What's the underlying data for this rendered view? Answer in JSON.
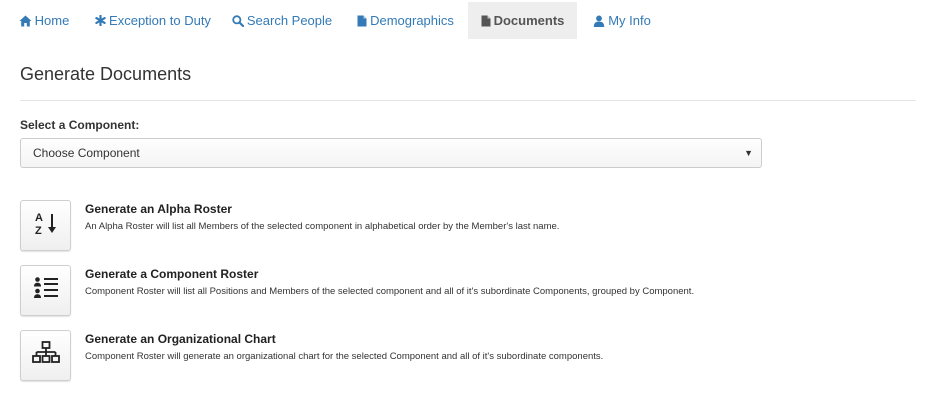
{
  "nav": {
    "items": [
      {
        "label": "Home",
        "icon": "home-icon"
      },
      {
        "label": "Exception to Duty",
        "icon": "asterisk-icon"
      },
      {
        "label": "Search People",
        "icon": "search-icon"
      },
      {
        "label": "Demographics",
        "icon": "file-icon"
      },
      {
        "label": "Documents",
        "icon": "file-icon",
        "active": true
      },
      {
        "label": "My Info",
        "icon": "user-icon"
      }
    ]
  },
  "page": {
    "title": "Generate Documents"
  },
  "component_select": {
    "label": "Select a Component:",
    "value": "Choose Component"
  },
  "documents": [
    {
      "title": "Generate an Alpha Roster",
      "description": "An Alpha Roster will list all Members of the selected component in alphabetical order by the Member's last name.",
      "icon": "sort-alpha-icon"
    },
    {
      "title": "Generate a Component Roster",
      "description": "Component Roster will list all Positions and Members of the selected component and all of it's subordinate Components, grouped by Component.",
      "icon": "user-list-icon"
    },
    {
      "title": "Generate an Organizational Chart",
      "description": "Component Roster will generate an organizational chart for the selected Component and all of it's subordinate components.",
      "icon": "org-chart-icon"
    }
  ],
  "colors": {
    "link": "#337ab7",
    "active_tab_bg": "#eeeeee"
  }
}
